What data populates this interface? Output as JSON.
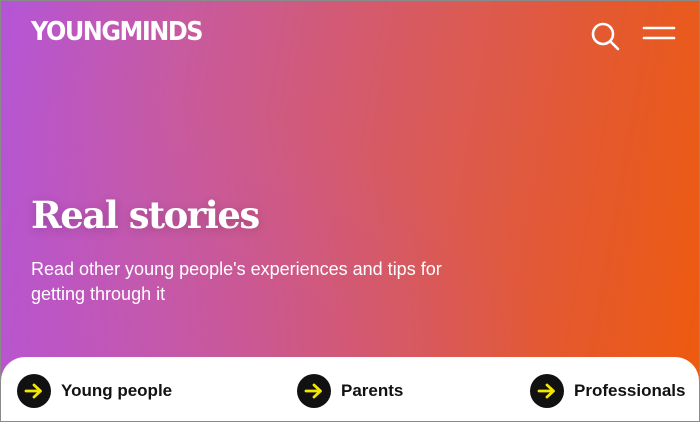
{
  "header": {
    "logo_text": "YOUNGMINDS",
    "search_icon": "search-icon",
    "menu_icon": "hamburger-menu-icon"
  },
  "hero": {
    "title": "Real stories",
    "subtitle": "Read other young people's experiences and tips for getting through it"
  },
  "audience_links": [
    {
      "label": "Young people",
      "icon": "arrow-right-icon"
    },
    {
      "label": "Parents",
      "icon": "arrow-right-icon"
    },
    {
      "label": "Professionals",
      "icon": "arrow-right-icon"
    }
  ],
  "colors": {
    "gradient_start": "#b455d8",
    "gradient_end": "#ee5a0d",
    "arrow_accent": "#f5e600",
    "circle_bg": "#111111",
    "text_light": "#ffffff"
  }
}
